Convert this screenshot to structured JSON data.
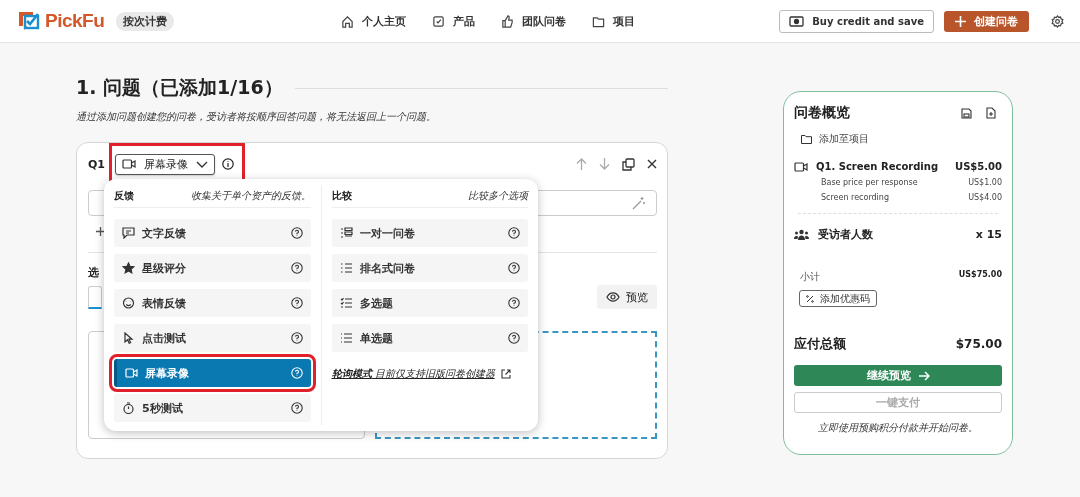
{
  "header": {
    "logo": "PickFu",
    "plan_badge": "按次计费",
    "nav": [
      "个人主页",
      "产品",
      "团队问卷",
      "项目"
    ],
    "buy_button": "Buy credit and save",
    "create_button": "创建问卷"
  },
  "section": {
    "title": "1. 问题（已添加1/16）",
    "description": "通过添加问题创建您的问卷，受访者将按顺序回答问题，将无法返回上一个问题。"
  },
  "question": {
    "label": "Q1",
    "type_selector": {
      "label": "屏幕录像",
      "highlighted": true
    },
    "options_label": "选",
    "preview_button": "预览"
  },
  "type_menu": {
    "columns": [
      {
        "title": "反馈",
        "subtitle": "收集关于单个资产的反馈。",
        "items": [
          {
            "label": "文字反馈",
            "selected": false,
            "highlighted": false
          },
          {
            "label": "星级评分",
            "selected": false,
            "highlighted": false
          },
          {
            "label": "表情反馈",
            "selected": false,
            "highlighted": false
          },
          {
            "label": "点击测试",
            "selected": false,
            "highlighted": false
          },
          {
            "label": "屏幕录像",
            "selected": true,
            "highlighted": true
          },
          {
            "label": "5秒测试",
            "selected": false,
            "highlighted": false
          }
        ]
      },
      {
        "title": "比较",
        "subtitle": "比较多个选项",
        "items": [
          {
            "label": "一对一问卷",
            "selected": false,
            "highlighted": false
          },
          {
            "label": "排名式问卷",
            "selected": false,
            "highlighted": false
          },
          {
            "label": "多选题",
            "selected": false,
            "highlighted": false
          },
          {
            "label": "单选题",
            "selected": false,
            "highlighted": false
          }
        ]
      }
    ],
    "note": "**轮询模式** 目前仅支持旧版问卷创建器"
  },
  "summary": {
    "title": "问卷概览",
    "add_to_project": "添加至项目",
    "line_item": {
      "title": "Q1. Screen Recording",
      "price": "US$5.00",
      "details": [
        {
          "label": "Base price per response",
          "price": "US$1.00"
        },
        {
          "label": "Screen recording",
          "price": "US$4.00"
        }
      ]
    },
    "respondents": {
      "label": "受访者人数",
      "value": "x 15"
    },
    "subtotal": {
      "label": "小计",
      "value": "US$75.00"
    },
    "coupon_button": "添加优惠码",
    "total": {
      "label": "应付总额",
      "value": "$75.00"
    },
    "continue_button": "继续预览",
    "pay_button": {
      "label": "一键支付",
      "disabled": true
    },
    "footnote": "立即使用预购积分付款并开始问卷。"
  }
}
